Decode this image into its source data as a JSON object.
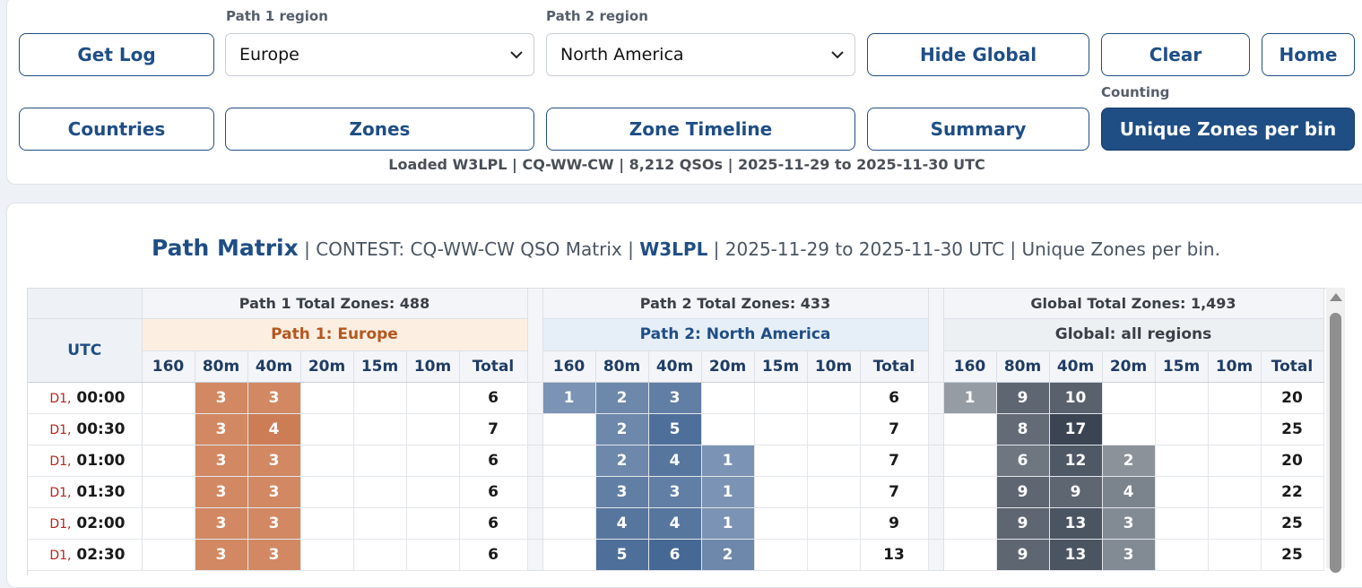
{
  "controls": {
    "get_log": "Get Log",
    "path1_label": "Path 1 region",
    "path1_value": "Europe",
    "path2_label": "Path 2 region",
    "path2_value": "North America",
    "hide_global": "Hide Global",
    "clear": "Clear",
    "home": "Home",
    "counting_label": "Counting",
    "countries": "Countries",
    "zones": "Zones",
    "zone_timeline": "Zone Timeline",
    "summary": "Summary",
    "unique_zones": "Unique Zones per bin",
    "status": "Loaded W3LPL | CQ-WW-CW | 8,212 QSOs | 2025-11-29 to 2025-11-30 UTC"
  },
  "title": {
    "main": "Path Matrix",
    "sep1": " | CONTEST: CQ-WW-CW QSO Matrix | ",
    "call": "W3LPL",
    "rest": " | 2025-11-29 to 2025-11-30 UTC | Unique Zones per bin."
  },
  "colors": {
    "accent": "#1f4e85",
    "path1_base": "#d98a5c",
    "path2_base": "#5b7fa6",
    "global_base": "#3f4a57"
  },
  "matrix": {
    "utc_header": "UTC",
    "bands": [
      "160",
      "80m",
      "40m",
      "20m",
      "15m",
      "10m",
      "Total"
    ],
    "groups": [
      {
        "key": "p1",
        "total_label": "Path 1 Total Zones: 488",
        "title": "Path 1: Europe",
        "rows": [
          [
            "",
            "3",
            "3",
            "",
            "",
            "",
            "6"
          ],
          [
            "",
            "3",
            "4",
            "",
            "",
            "",
            "7"
          ],
          [
            "",
            "3",
            "3",
            "",
            "",
            "",
            "6"
          ],
          [
            "",
            "3",
            "3",
            "",
            "",
            "",
            "6"
          ],
          [
            "",
            "3",
            "3",
            "",
            "",
            "",
            "6"
          ],
          [
            "",
            "3",
            "3",
            "",
            "",
            "",
            "6"
          ]
        ]
      },
      {
        "key": "p2",
        "total_label": "Path 2 Total Zones: 433",
        "title": "Path 2: North America",
        "rows": [
          [
            "1",
            "2",
            "3",
            "",
            "",
            "",
            "6"
          ],
          [
            "",
            "2",
            "5",
            "",
            "",
            "",
            "7"
          ],
          [
            "",
            "2",
            "4",
            "1",
            "",
            "",
            "7"
          ],
          [
            "",
            "3",
            "3",
            "1",
            "",
            "",
            "7"
          ],
          [
            "",
            "4",
            "4",
            "1",
            "",
            "",
            "9"
          ],
          [
            "",
            "5",
            "6",
            "2",
            "",
            "",
            "13"
          ]
        ]
      },
      {
        "key": "g",
        "total_label": "Global Total Zones: 1,493",
        "title": "Global: all regions",
        "rows": [
          [
            "1",
            "9",
            "10",
            "",
            "",
            "",
            "20"
          ],
          [
            "",
            "8",
            "17",
            "",
            "",
            "",
            "25"
          ],
          [
            "",
            "6",
            "12",
            "2",
            "",
            "",
            "20"
          ],
          [
            "",
            "9",
            "9",
            "4",
            "",
            "",
            "22"
          ],
          [
            "",
            "9",
            "13",
            "3",
            "",
            "",
            "25"
          ],
          [
            "",
            "9",
            "13",
            "3",
            "",
            "",
            "25"
          ]
        ]
      }
    ],
    "times": [
      {
        "day": "D1,",
        "time": "00:00"
      },
      {
        "day": "D1,",
        "time": "00:30"
      },
      {
        "day": "D1,",
        "time": "01:00"
      },
      {
        "day": "D1,",
        "time": "01:30"
      },
      {
        "day": "D1,",
        "time": "02:00"
      },
      {
        "day": "D1,",
        "time": "02:30"
      }
    ]
  }
}
